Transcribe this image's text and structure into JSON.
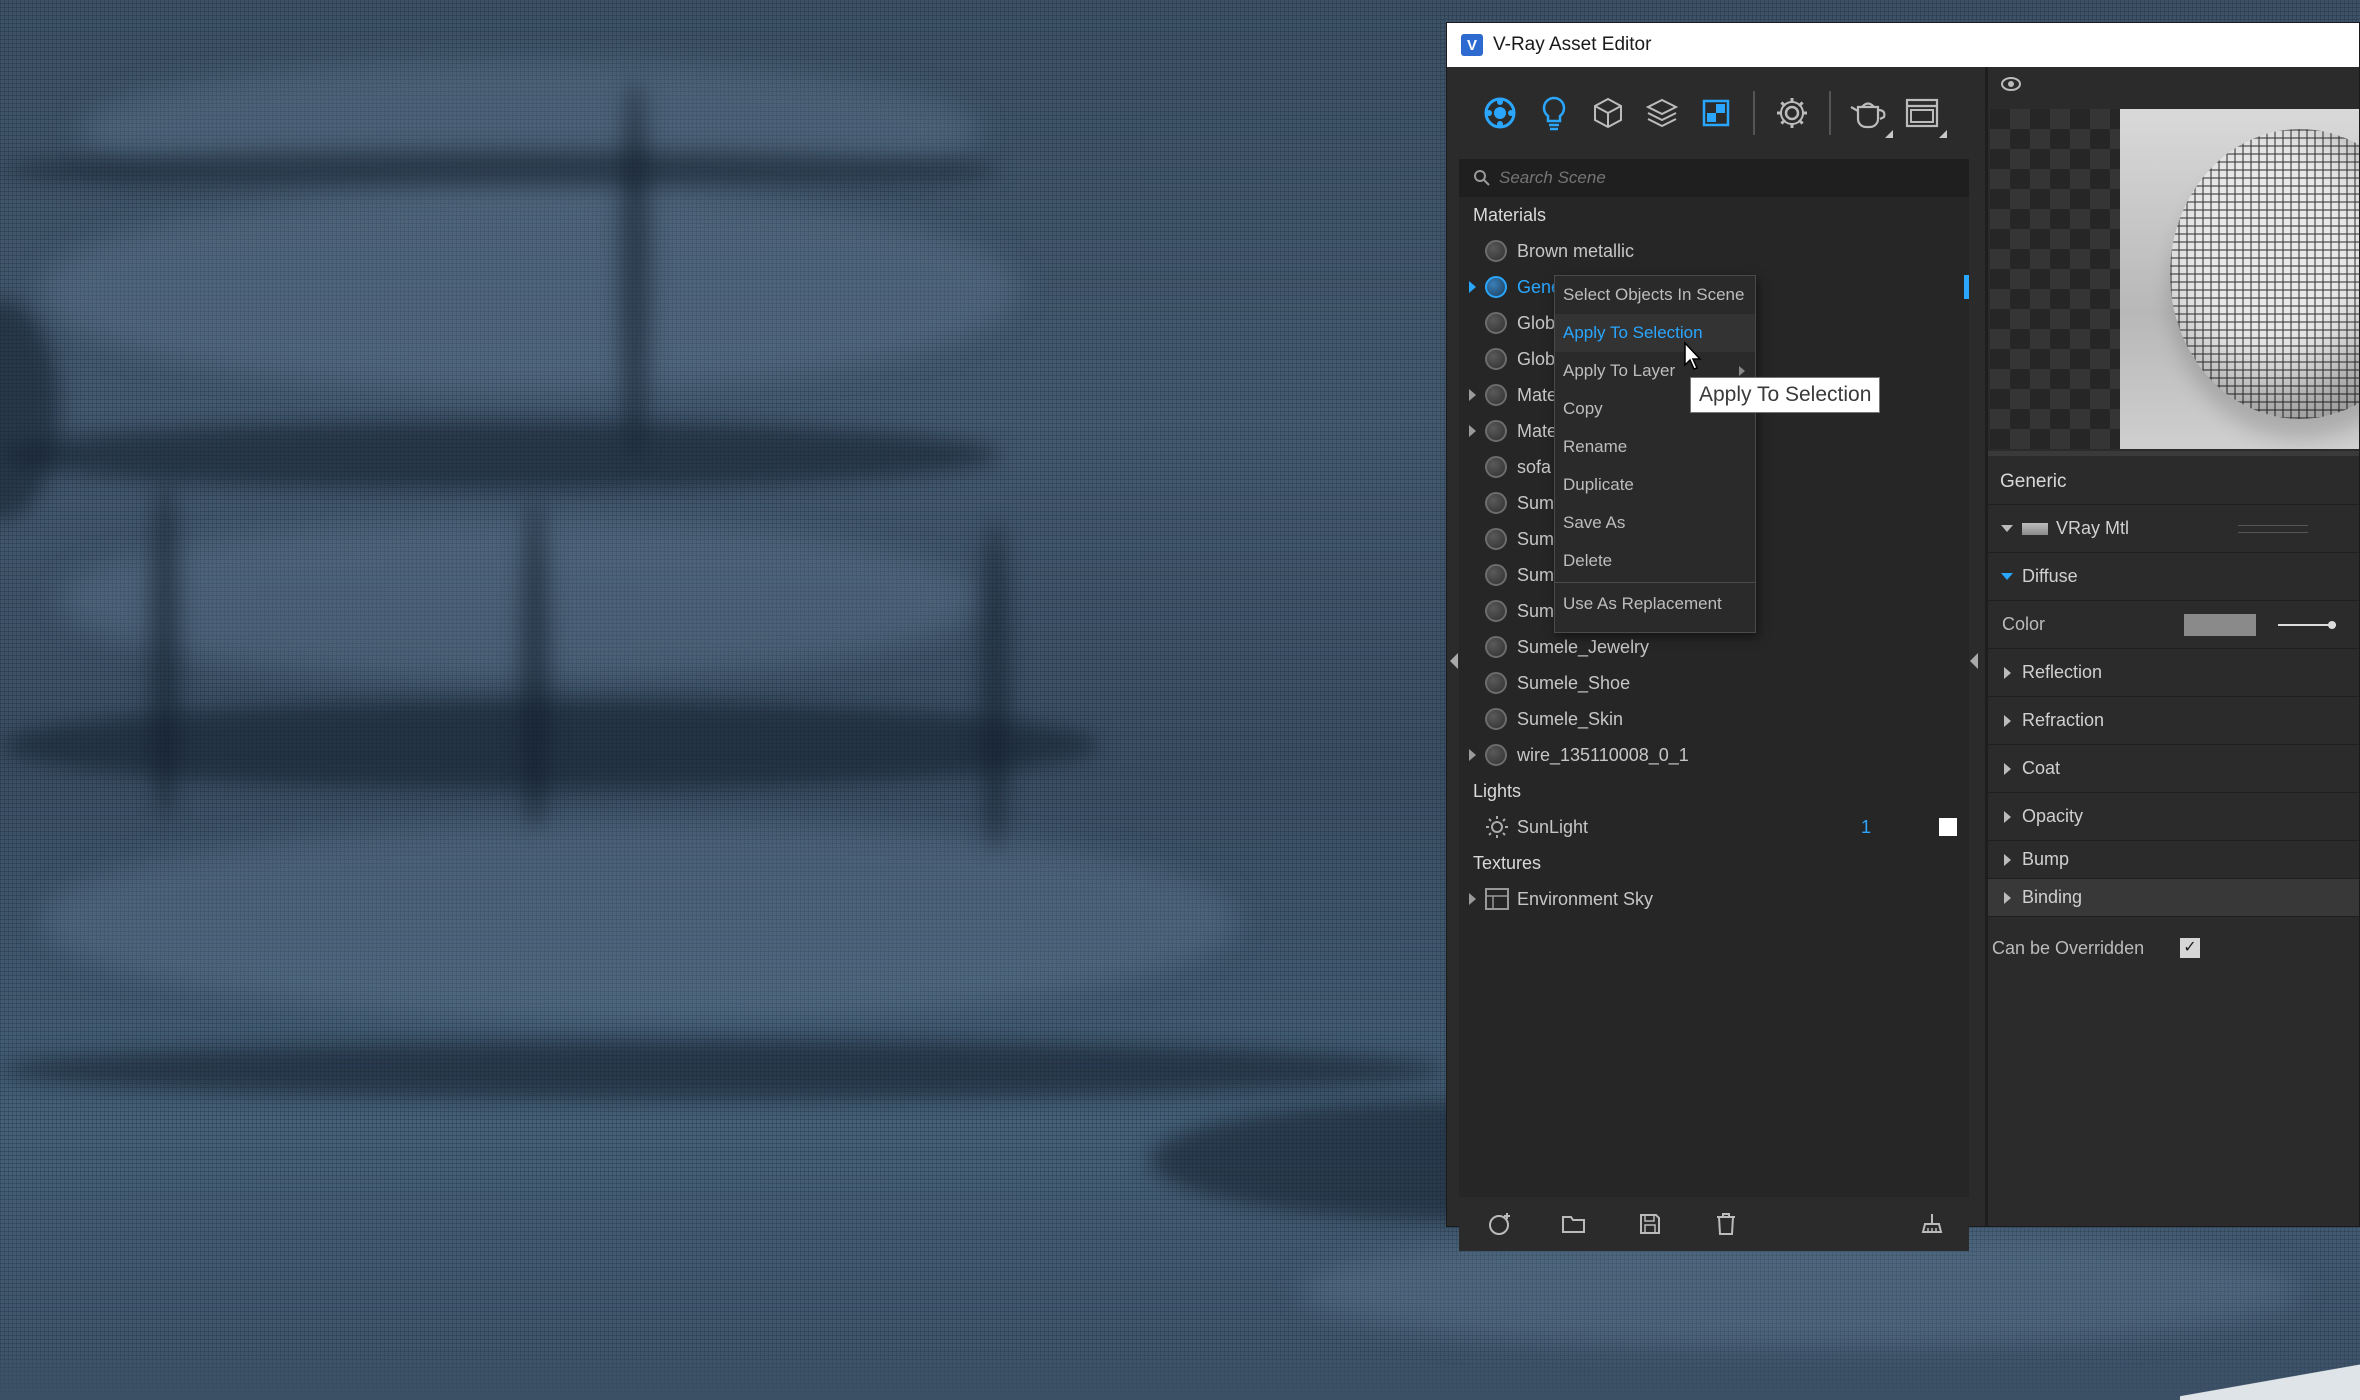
{
  "window": {
    "title": "V-Ray Asset Editor"
  },
  "toolbar": {
    "icons": [
      "materials-icon",
      "lights-icon",
      "geometry-icon",
      "layers-icon",
      "textures-icon",
      "settings-icon",
      "render-teapot-icon",
      "frame-buffer-icon"
    ]
  },
  "search": {
    "placeholder": "Search Scene"
  },
  "sections": {
    "materials": "Materials",
    "lights": "Lights",
    "textures": "Textures"
  },
  "materials": [
    {
      "label": "Brown metallic",
      "expandable": false
    },
    {
      "label": "Generic",
      "expandable": true,
      "selected": true
    },
    {
      "label": "Glob",
      "expandable": false
    },
    {
      "label": "Glob",
      "expandable": false
    },
    {
      "label": "Mate",
      "expandable": true
    },
    {
      "label": "Mate",
      "expandable": true
    },
    {
      "label": "sofa",
      "expandable": false
    },
    {
      "label": "Sum",
      "expandable": false
    },
    {
      "label": "Sum",
      "expandable": false
    },
    {
      "label": "Sum",
      "expandable": false
    },
    {
      "label": "Sum",
      "expandable": false
    },
    {
      "label": "Sumele_Jewelry",
      "expandable": false
    },
    {
      "label": "Sumele_Shoe",
      "expandable": false
    },
    {
      "label": "Sumele_Skin",
      "expandable": false
    },
    {
      "label": "wire_135110008_0_1",
      "expandable": true
    }
  ],
  "lights": [
    {
      "label": "SunLight",
      "count": "1"
    }
  ],
  "textures": [
    {
      "label": "Environment Sky"
    }
  ],
  "context_menu": {
    "items": [
      "Select Objects In Scene",
      "Apply To Selection",
      "Apply To Layer",
      "Copy",
      "Rename",
      "Duplicate",
      "Save As",
      "Delete",
      "Use As Replacement"
    ],
    "hovered": "Apply To Selection"
  },
  "tooltip": "Apply To Selection",
  "properties": {
    "title": "Generic",
    "material_type": "VRay Mtl",
    "diffuse": "Diffuse",
    "color_label": "Color",
    "color_value": "#8a8a8a",
    "groups": [
      "Reflection",
      "Refraction",
      "Coat",
      "Opacity",
      "Bump",
      "Binding"
    ],
    "can_be_overridden_label": "Can be Overridden",
    "can_be_overridden": true
  },
  "colors": {
    "accent": "#2aa6ff",
    "panel": "#2b2b2b",
    "fabric": "#3e5368"
  }
}
